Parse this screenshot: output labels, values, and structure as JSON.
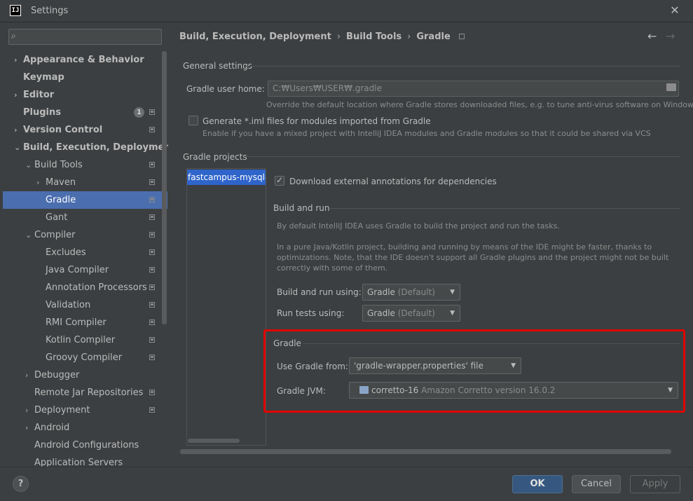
{
  "window": {
    "title": "Settings",
    "logo_text": "IJ"
  },
  "search": {
    "placeholder": ""
  },
  "sidebar": {
    "items": [
      {
        "label": "Appearance & Behavior",
        "chevron": "›"
      },
      {
        "label": "Keymap"
      },
      {
        "label": "Editor",
        "chevron": "›"
      },
      {
        "label": "Plugins",
        "badge": "1"
      },
      {
        "label": "Version Control",
        "chevron": "›"
      },
      {
        "label": "Build, Execution, Deployment",
        "chevron": "⌄"
      },
      {
        "label": "Build Tools",
        "chevron": "⌄"
      },
      {
        "label": "Maven",
        "chevron": "›"
      },
      {
        "label": "Gradle"
      },
      {
        "label": "Gant"
      },
      {
        "label": "Compiler",
        "chevron": "⌄"
      },
      {
        "label": "Excludes"
      },
      {
        "label": "Java Compiler"
      },
      {
        "label": "Annotation Processors"
      },
      {
        "label": "Validation"
      },
      {
        "label": "RMI Compiler"
      },
      {
        "label": "Kotlin Compiler"
      },
      {
        "label": "Groovy Compiler"
      },
      {
        "label": "Debugger",
        "chevron": "›"
      },
      {
        "label": "Remote Jar Repositories"
      },
      {
        "label": "Deployment",
        "chevron": "›"
      },
      {
        "label": "Android",
        "chevron": "›"
      },
      {
        "label": "Android Configurations"
      },
      {
        "label": "Application Servers"
      }
    ]
  },
  "breadcrumb": {
    "part1": "Build, Execution, Deployment",
    "part2": "Build Tools",
    "part3": "Gradle",
    "sep": "›"
  },
  "nav": {
    "back": "←",
    "forward": "→"
  },
  "general": {
    "title": "General settings",
    "user_home_label": "Gradle user home:",
    "user_home_value": "C:₩Users₩USER₩.gradle",
    "user_home_hint": "Override the default location where Gradle stores downloaded files, e.g. to tune anti-virus software on Windows",
    "iml_label": "Generate *.iml files for modules imported from Gradle",
    "iml_hint": "Enable if you have a mixed project with IntelliJ IDEA modules and Gradle modules so that it could be shared via VCS"
  },
  "projects": {
    "title": "Gradle projects",
    "selected_project": "fastcampus-mysql-ir",
    "download_annotations_label": "Download external annotations for dependencies"
  },
  "build_run": {
    "title": "Build and run",
    "desc1": "By default IntelliJ IDEA uses Gradle to build the project and run the tasks.",
    "desc2_line1": "In a pure Java/Kotlin project, building and running by means of the IDE might be faster, thanks to",
    "desc2_line2": "optimizations. Note, that the IDE doesn't support all Gradle plugins and the project might not be built",
    "desc2_line3": "correctly with some of them.",
    "build_using_label": "Build and run using:",
    "build_using_value": "Gradle",
    "build_using_dim": "(Default)",
    "tests_using_label": "Run tests using:",
    "tests_using_value": "Gradle",
    "tests_using_dim": "(Default)"
  },
  "gradle": {
    "title": "Gradle",
    "use_from_label": "Use Gradle from:",
    "use_from_value": "'gradle-wrapper.properties' file",
    "jvm_label": "Gradle JVM:",
    "jvm_value": "corretto-16",
    "jvm_dim": "Amazon Corretto version 16.0.2"
  },
  "footer": {
    "help": "?",
    "ok": "OK",
    "cancel": "Cancel",
    "apply": "Apply"
  },
  "colors": {
    "background": "#3c3f41",
    "selection": "#4b6eaf",
    "highlight_box": "#e00000",
    "ok_button": "#365880"
  }
}
